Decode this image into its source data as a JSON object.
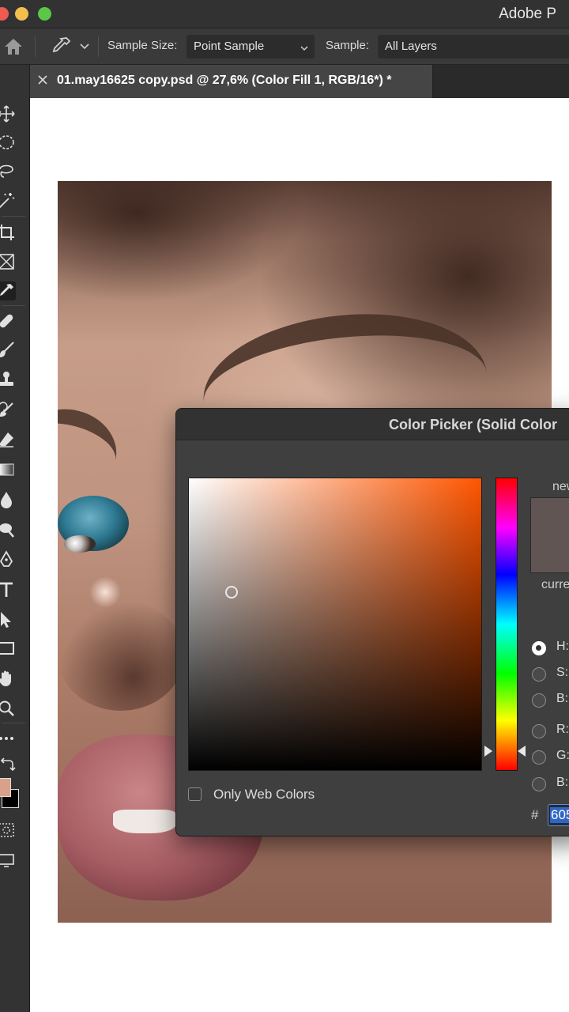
{
  "window": {
    "app_title": "Adobe P"
  },
  "options_bar": {
    "sample_size_label": "Sample Size:",
    "sample_size_value": "Point Sample",
    "sample_label": "Sample:",
    "sample_value": "All Layers"
  },
  "document_tab": {
    "title": "01.may16625 copy.psd @ 27,6% (Color Fill 1, RGB/16*) *"
  },
  "toolbar": {
    "tools": [
      "move-tool",
      "marquee-tool",
      "lasso-tool",
      "magic-wand-tool",
      "crop-tool",
      "frame-tool",
      "eyedropper-tool",
      "healing-brush-tool",
      "brush-tool",
      "clone-stamp-tool",
      "history-brush-tool",
      "eraser-tool",
      "gradient-tool",
      "blur-tool",
      "dodge-tool",
      "pen-tool",
      "type-tool",
      "path-selection-tool",
      "rectangle-tool",
      "hand-tool",
      "zoom-tool",
      "more-tools",
      "swap-colors",
      "color-swatches",
      "quick-mask",
      "screen-mode"
    ],
    "active_tool": "eyedropper-tool",
    "foreground_color": "#d9a08a",
    "background_color": "#000000"
  },
  "color_picker": {
    "title": "Color Picker (Solid Color",
    "hue_base_color": "#ff5500",
    "new_label": "new",
    "current_label": "curre",
    "swatch_color": "#605553",
    "mode_labels": [
      "H:",
      "S:",
      "B:",
      "R:",
      "G:",
      "B:"
    ],
    "selected_mode": "H:",
    "only_web_colors_label": "Only Web Colors",
    "only_web_colors_checked": false,
    "hash_label": "#",
    "hex_value": "605"
  }
}
